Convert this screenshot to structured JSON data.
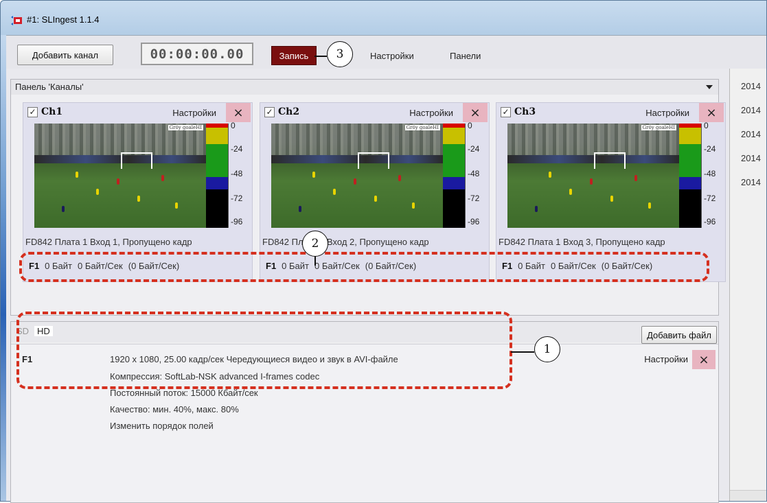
{
  "window": {
    "title": "#1: SLIngest 1.1.4"
  },
  "toolbar": {
    "add_channel_label": "Добавить канал",
    "timer": "00:00:00.00",
    "record_label": "Запись",
    "settings_label": "Настройки",
    "panels_label": "Панели"
  },
  "channels_panel": {
    "title": "Панель 'Каналы'",
    "channels": [
      {
        "name": "Ch1",
        "checked": "✓",
        "settings_label": "Настройки",
        "close_label": "×",
        "info": "FD842 Плата 1 Вход 1,  Пропущено кадр",
        "stats": {
          "format": "F1",
          "bytes": "0 Байт",
          "rate": "0 Байт/Сек",
          "rate2": "(0 Байт/Сек)"
        }
      },
      {
        "name": "Ch2",
        "checked": "✓",
        "settings_label": "Настройки",
        "close_label": "×",
        "info": "FD842 Плата 1 Вход 2,  Пропущено кадр",
        "stats": {
          "format": "F1",
          "bytes": "0 Байт",
          "rate": "0 Байт/Сек",
          "rate2": "(0 Байт/Сек)"
        }
      },
      {
        "name": "Ch3",
        "checked": "✓",
        "settings_label": "Настройки",
        "close_label": "×",
        "info": "FD842 Плата 1 Вход 3,  Пропущено кадр",
        "stats": {
          "format": "F1",
          "bytes": "0 Байт",
          "rate": "0 Байт/Сек",
          "rate2": "(0 Байт/Сек)"
        }
      }
    ],
    "meter_scale": [
      "0",
      "-24",
      "-48",
      "-72",
      "-96"
    ],
    "video_watermark": "Gröy goaleHI"
  },
  "formats_panel": {
    "tabs": [
      "SD",
      "HD"
    ],
    "active_tab": "HD",
    "add_file_label": "Добавить файл",
    "item": {
      "label": "F1",
      "lines": [
        "1920 x 1080, 25.00 кадр/сек    Чередующиеся видео и звук в AVI-файле",
        "Компрессия: SoftLab-NSK advanced I-frames codec",
        "Постоянный поток: 15000 Кбайт/сек",
        "Качество: мин. 40%, макс. 80%",
        "Изменить порядок полей"
      ],
      "settings_label": "Настройки",
      "close_label": "×"
    }
  },
  "right_panel": {
    "items": [
      "2014",
      "2014",
      "2014",
      "2014",
      "2014"
    ]
  },
  "callouts": [
    "1",
    "2",
    "3"
  ],
  "colors": {
    "record": "#7a0f0f",
    "close_bg": "#e8b4c0",
    "annotation": "#d5301f",
    "meter_red": "#d80000",
    "meter_yellow": "#c8c000",
    "meter_green": "#1a9a1a",
    "meter_blue": "#1a1aa0"
  }
}
